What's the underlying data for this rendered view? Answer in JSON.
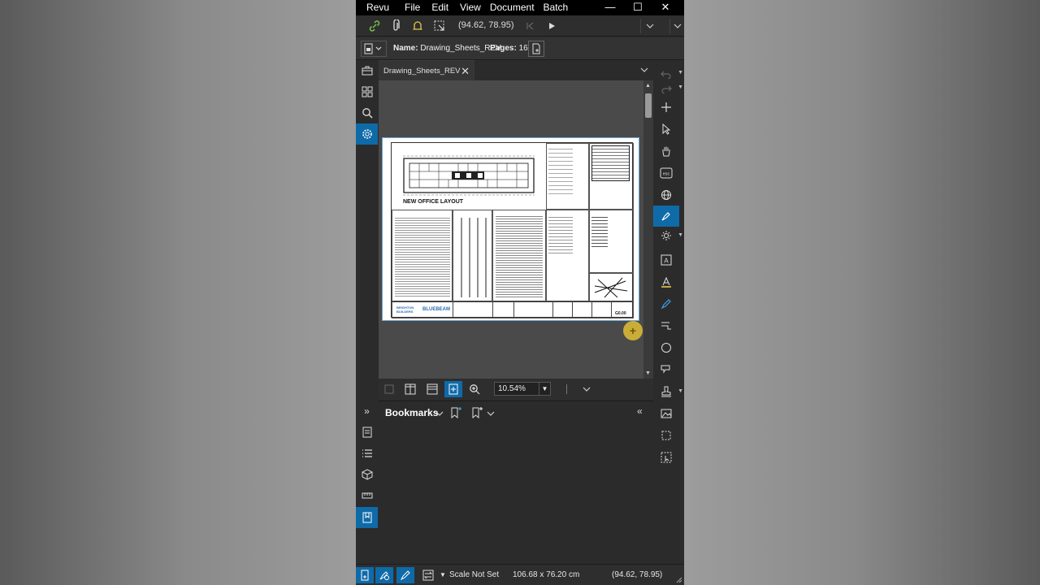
{
  "menu": {
    "items": [
      "Revu",
      "File",
      "Edit",
      "View",
      "Document",
      "Batch"
    ],
    "minimize": "—",
    "maximize": "☐",
    "close": "✕"
  },
  "quickbar": {
    "coordinates": "(94.62, 78.95)"
  },
  "docbar": {
    "name_label": "Name:",
    "name_value": "Drawing_Sheets_REV",
    "pages_label": "Pages:",
    "pages_value": "16"
  },
  "tab": {
    "label": "Drawing_Sheets_REV",
    "close": "✕"
  },
  "sheet": {
    "title": "NEW OFFICE LAYOUT",
    "brand": "BLUEBEAM",
    "brand_left": "BRIGHTON BUILDERS",
    "sheet_code": "G0.00"
  },
  "viewbar": {
    "zoom": "10.54%"
  },
  "bookmarks": {
    "title": "Bookmarks"
  },
  "status": {
    "scale": "Scale Not Set",
    "size": "106.68 x 76.20 cm",
    "coordinates": "(94.62, 78.95)"
  },
  "colors": {
    "accent": "#0f6aa8",
    "cursor": "#e0be32",
    "link_icon": "#7cc24a"
  }
}
